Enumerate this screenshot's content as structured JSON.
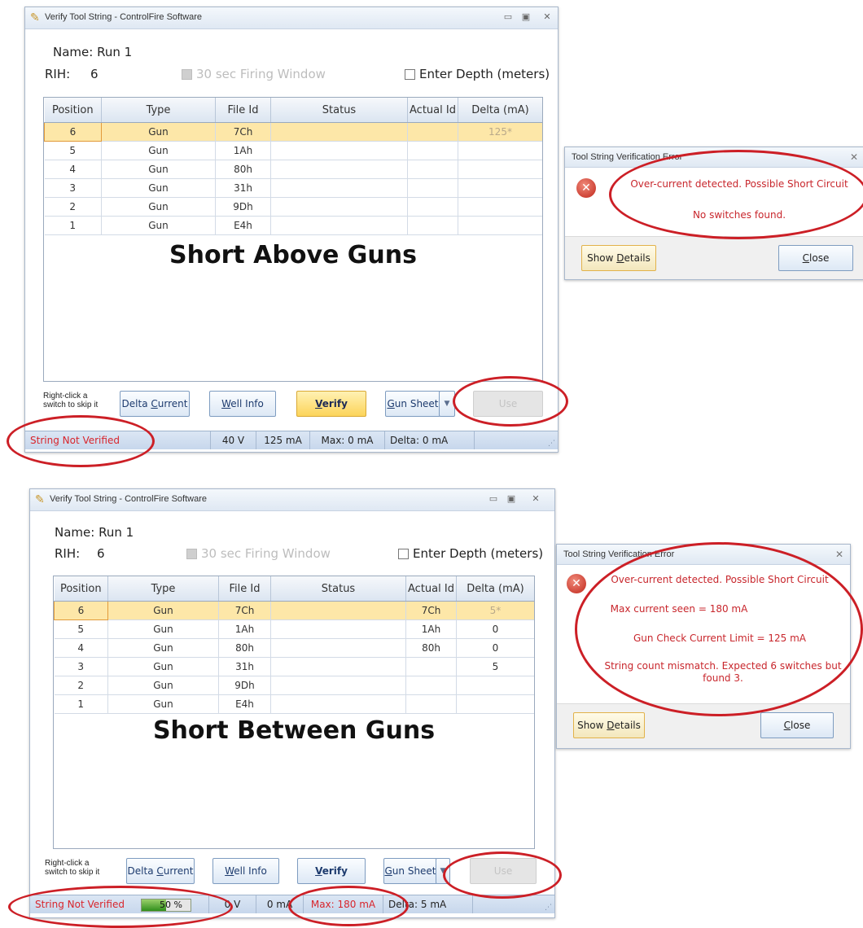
{
  "window_title": "Verify Tool String - ControlFire Software",
  "name_label": "Name:",
  "name_value": "Run 1",
  "rih_label": "RIH:",
  "rih_value": "6",
  "firing_window_label": "30 sec Firing Window",
  "firing_window_underline": "F",
  "enter_depth_label": "Enter Depth (meters)",
  "columns": [
    "Position",
    "Type",
    "File Id",
    "Status",
    "Actual Id",
    "Delta (mA)"
  ],
  "hint": "Right-click a switch to skip it",
  "buttons": {
    "delta_current": "Delta Current",
    "well_info": "Well Info",
    "verify": "Verify",
    "gun_sheet": "Gun Sheet",
    "use": "Use"
  },
  "error_dialog_title": "Tool String Verification Error",
  "dialog_buttons": {
    "show_details": "Show Details",
    "close": "Close"
  },
  "panel1": {
    "caption": "Short Above Guns",
    "rows": [
      {
        "position": "6",
        "type": "Gun",
        "file_id": "7Ch",
        "status": "",
        "actual_id": "",
        "delta": "125*"
      },
      {
        "position": "5",
        "type": "Gun",
        "file_id": "1Ah",
        "status": "",
        "actual_id": "",
        "delta": ""
      },
      {
        "position": "4",
        "type": "Gun",
        "file_id": "80h",
        "status": "",
        "actual_id": "",
        "delta": ""
      },
      {
        "position": "3",
        "type": "Gun",
        "file_id": "31h",
        "status": "",
        "actual_id": "",
        "delta": ""
      },
      {
        "position": "2",
        "type": "Gun",
        "file_id": "9Dh",
        "status": "",
        "actual_id": "",
        "delta": ""
      },
      {
        "position": "1",
        "type": "Gun",
        "file_id": "E4h",
        "status": "",
        "actual_id": "",
        "delta": ""
      }
    ],
    "status": {
      "verified": "String Not Verified",
      "voltage": "40 V",
      "current": "125 mA",
      "max": "Max: 0 mA",
      "delta": "Delta: 0 mA"
    },
    "dialog": {
      "line1": "Over-current detected. Possible Short Circuit",
      "line2": "No switches found."
    }
  },
  "panel2": {
    "caption": "Short Between Guns",
    "rows": [
      {
        "position": "6",
        "type": "Gun",
        "file_id": "7Ch",
        "status": "",
        "actual_id": "7Ch",
        "delta": "5*"
      },
      {
        "position": "5",
        "type": "Gun",
        "file_id": "1Ah",
        "status": "",
        "actual_id": "1Ah",
        "delta": "0"
      },
      {
        "position": "4",
        "type": "Gun",
        "file_id": "80h",
        "status": "",
        "actual_id": "80h",
        "delta": "0"
      },
      {
        "position": "3",
        "type": "Gun",
        "file_id": "31h",
        "status": "",
        "actual_id": "",
        "delta": "5"
      },
      {
        "position": "2",
        "type": "Gun",
        "file_id": "9Dh",
        "status": "",
        "actual_id": "",
        "delta": ""
      },
      {
        "position": "1",
        "type": "Gun",
        "file_id": "E4h",
        "status": "",
        "actual_id": "",
        "delta": ""
      }
    ],
    "status": {
      "verified": "String Not Verified",
      "progress_label": "50 %",
      "progress_value": 0.5,
      "voltage": "0 V",
      "current": "0 mA",
      "max": "Max: 180 mA",
      "delta": "Delta: 5 mA"
    },
    "dialog": {
      "line1": "Over-current detected. Possible Short Circuit",
      "line2": "Max current seen = 180 mA",
      "line3": "Gun Check Current Limit = 125 mA",
      "line4": "String count mismatch. Expected 6 switches but found 3."
    }
  }
}
